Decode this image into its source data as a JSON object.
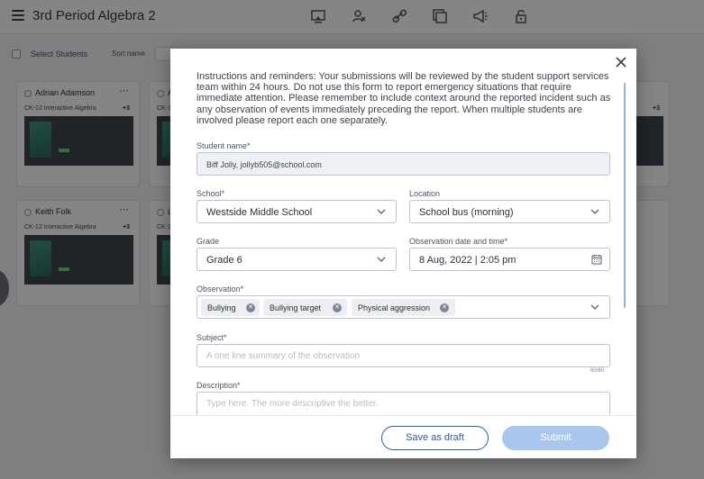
{
  "app": {
    "title": "3rd Period Algebra 2",
    "toolbar": {
      "select_students": "Select Students",
      "sort_name": "Sort name"
    },
    "top_icons": [
      "projector-icon",
      "assign-icon",
      "link-icon",
      "copy-icon",
      "megaphone-icon",
      "lock-icon"
    ],
    "cards": [
      {
        "name": "Adrian Adamson",
        "course": "CK-12 Interactive Algebra",
        "count": "+3"
      },
      {
        "name": "A",
        "course": "CK-12",
        "count": ""
      },
      {
        "name": "",
        "course": "",
        "count": "+3"
      },
      {
        "name": "Keith Folk",
        "course": "CK-12 Interactive Algebra",
        "count": "+3"
      },
      {
        "name": "L",
        "course": "CK-12",
        "count": ""
      }
    ]
  },
  "modal": {
    "intro": "Instructions and reminders: Your submissions will be reviewed by the student support services team within 24 hours. Do not use this form to report emergency situations that require immediate attention. Please remember to include context around the reported incident such as any observation of events immediately preceding the report. When multiple students are involved please report each one separately.",
    "student_name": {
      "label": "Student name*",
      "value": "Biff Jolly, jollyb505@school.com"
    },
    "school": {
      "label": "School*",
      "value": "Westside Middle School"
    },
    "location": {
      "label": "Location",
      "value": "School bus (morning)"
    },
    "grade": {
      "label": "Grade",
      "value": "Grade 6"
    },
    "observation_date": {
      "label": "Observation date and time*",
      "value": "8 Aug, 2022 | 2:05 pm"
    },
    "observation": {
      "label": "Observation*",
      "tags": [
        "Bullying",
        "Bullying target",
        "Physical aggression"
      ]
    },
    "subject": {
      "label": "Subject*",
      "placeholder": "A one line summary of the observation",
      "counter": "60/60"
    },
    "description": {
      "label": "Description*",
      "placeholder": "Type here. The more descriptive the better."
    },
    "buttons": {
      "save_draft": "Save as draft",
      "submit": "Submit"
    },
    "colors": {
      "accent": "#2f5a9e",
      "submit_disabled": "#a9c6ec",
      "field_border": "#b9c5d6"
    }
  }
}
